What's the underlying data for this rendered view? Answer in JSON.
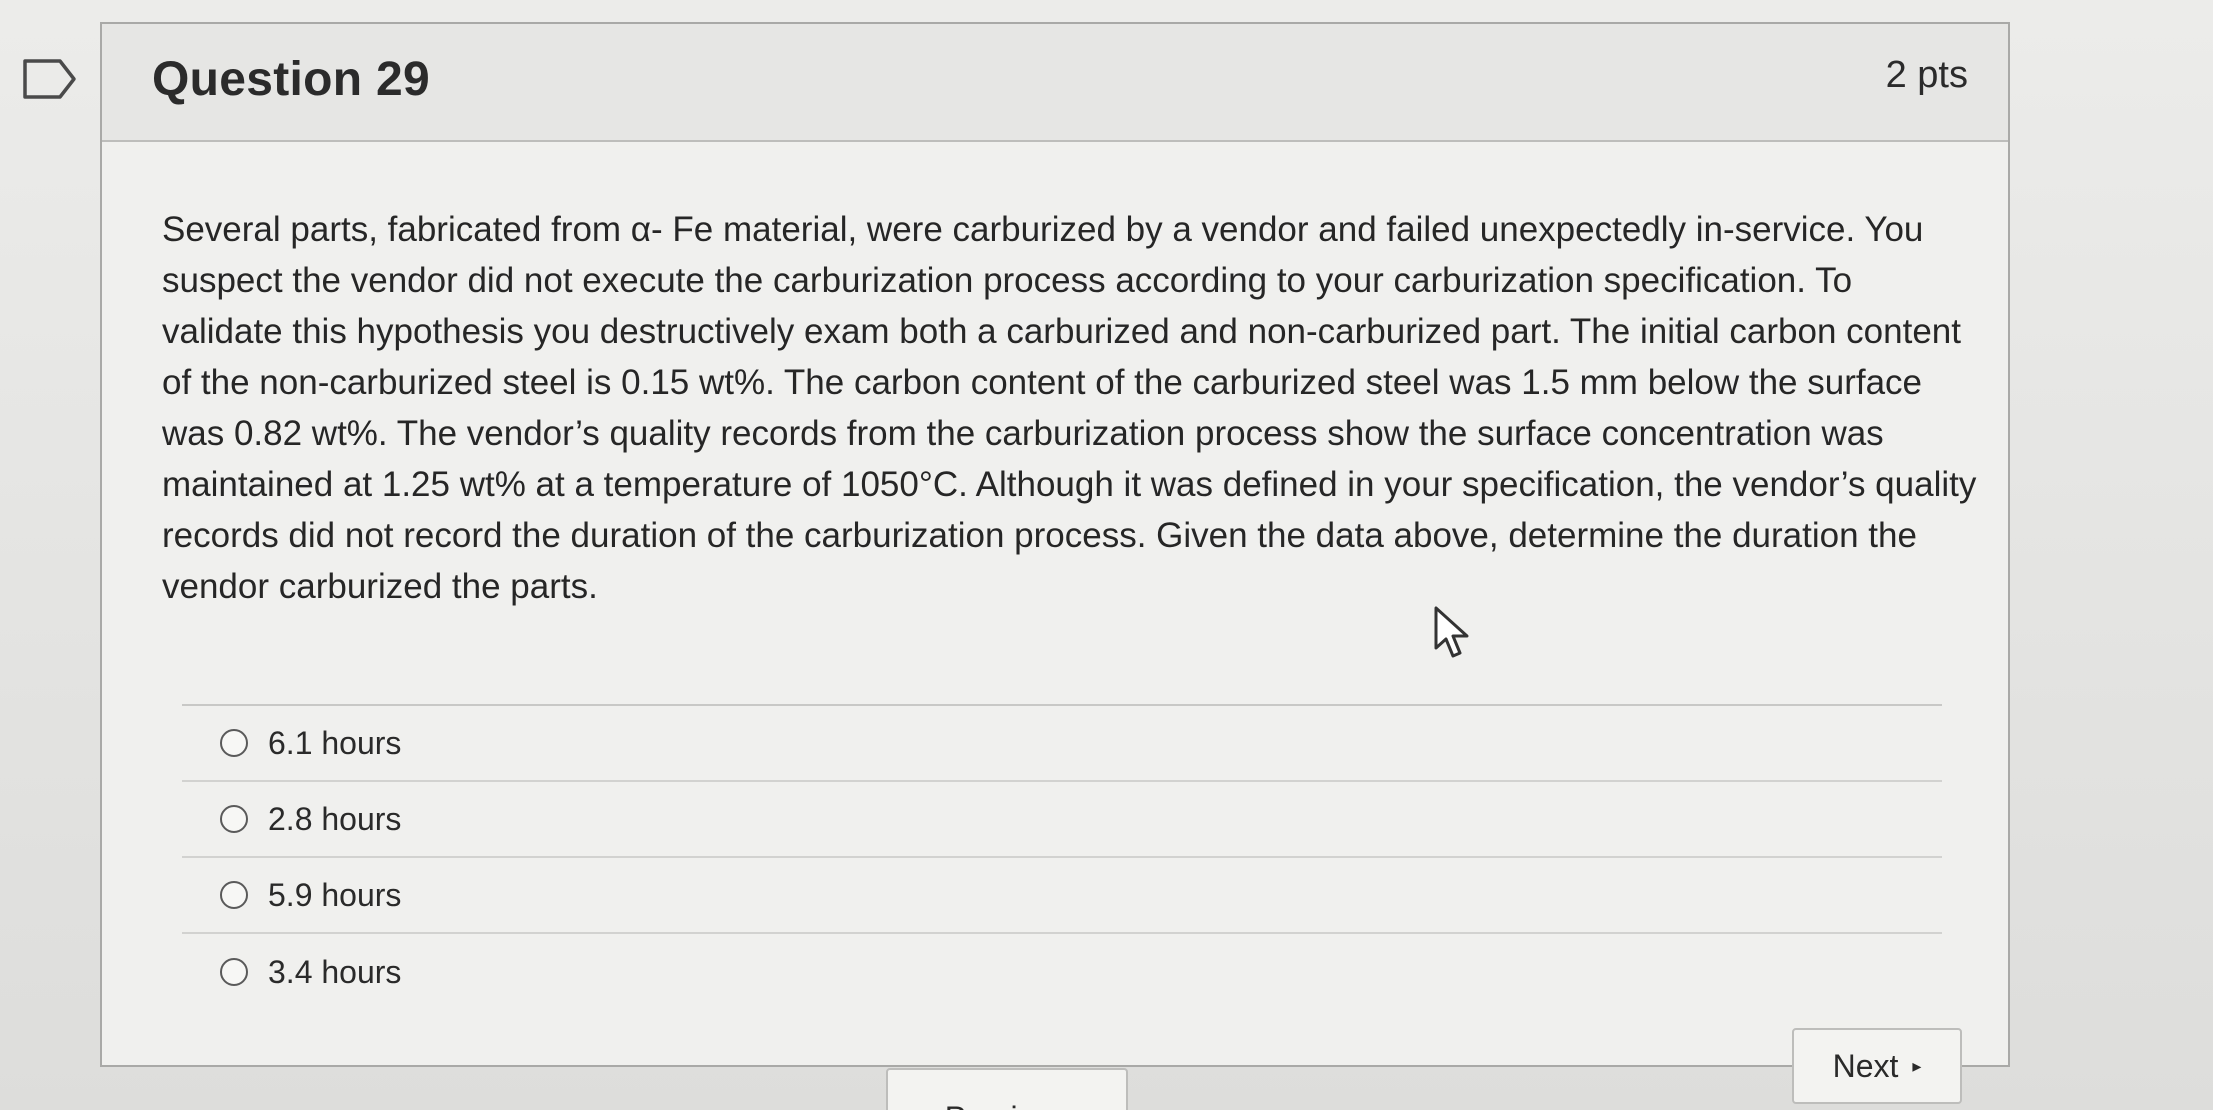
{
  "question": {
    "title": "Question 29",
    "points": "2 pts",
    "text": "Several parts, fabricated from α- Fe material, were carburized by a vendor and failed unexpectedly in-service. You suspect the vendor did not execute the carburization process according to your carburization specification. To validate this hypothesis you destructively exam both a carburized and non-carburized part. The initial carbon content of the non-carburized steel is 0.15 wt%. The carbon content of the carburized steel was 1.5 mm below the surface was 0.82 wt%. The vendor’s quality records from the carburization process show the surface concentration was maintained at 1.25 wt% at a temperature of 1050°C. Although it was defined in your specification, the vendor’s quality records did not record the duration of the carburization process. Given the data above, determine the duration the vendor carburized the parts.",
    "answers": [
      {
        "label": "6.1 hours"
      },
      {
        "label": "2.8 hours"
      },
      {
        "label": "5.9 hours"
      },
      {
        "label": "3.4 hours"
      }
    ]
  },
  "navigation": {
    "next_label": "Next",
    "next_icon": "caret-right-icon",
    "previous_label": "Previous"
  },
  "icons": {
    "flag": "flag-bookmark-icon",
    "cursor": "mouse-pointer-icon"
  }
}
